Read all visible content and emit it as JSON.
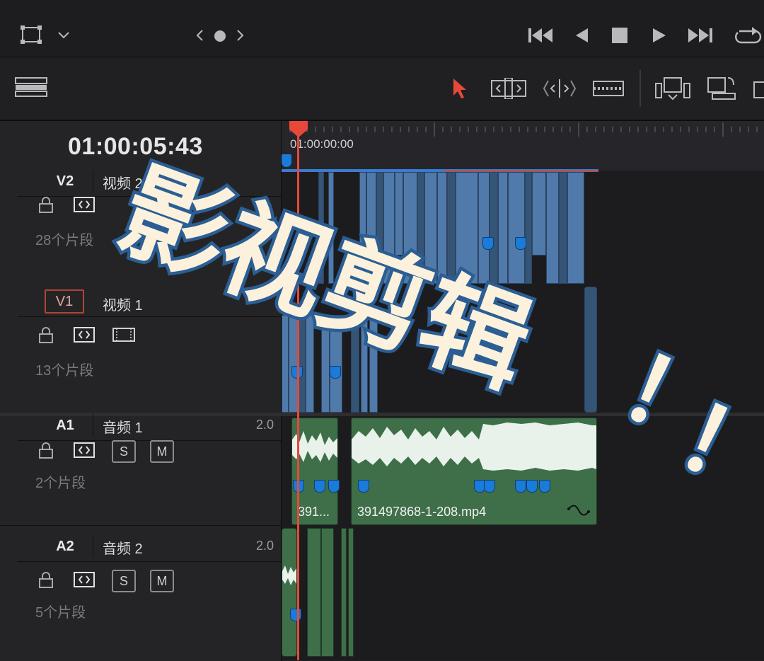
{
  "transport": {
    "icons": [
      "viewer-size-icon",
      "chevron-down-icon",
      "prev-icon",
      "dot-icon",
      "next-icon",
      "go-to-start-icon",
      "play-reverse-icon",
      "stop-icon",
      "play-icon",
      "go-to-end-icon",
      "loop-icon"
    ]
  },
  "toolbar": {
    "icons": [
      "timeline-view-icon",
      "selection-arrow-icon",
      "trim-edit-icon",
      "dynamic-trim-icon",
      "blade-icon",
      "insert-clip-icon",
      "overwrite-clip-icon",
      "replace-clip-icon"
    ]
  },
  "timeline": {
    "timecode": "01:00:05:43",
    "ruler_start": "01:00:00:00"
  },
  "tracks": [
    {
      "id": "V2",
      "name": "视频 2",
      "clip_count": "28个片段"
    },
    {
      "id": "V1",
      "name": "视频 1",
      "clip_count": "13个片段"
    },
    {
      "id": "A1",
      "name": "音频 1",
      "channels": "2.0",
      "clip_count": "2个片段",
      "solo": "S",
      "mute": "M"
    },
    {
      "id": "A2",
      "name": "音频 2",
      "channels": "2.0",
      "clip_count": "5个片段",
      "solo": "S",
      "mute": "M"
    }
  ],
  "clips": {
    "a1_clip1_name": "391...",
    "a1_clip2_name": "391497868-1-208.mp4"
  },
  "overlay": {
    "title": "影视剪辑",
    "exclaims": [
      "！",
      "！",
      "！"
    ],
    "fill_color": "#fbf1dc",
    "outline_color": "#2b5e94"
  },
  "colors": {
    "playhead": "#e8483a",
    "video_clip": "#4f7aaa",
    "audio_clip": "#3e6f49",
    "marker": "#1a7bd8"
  }
}
